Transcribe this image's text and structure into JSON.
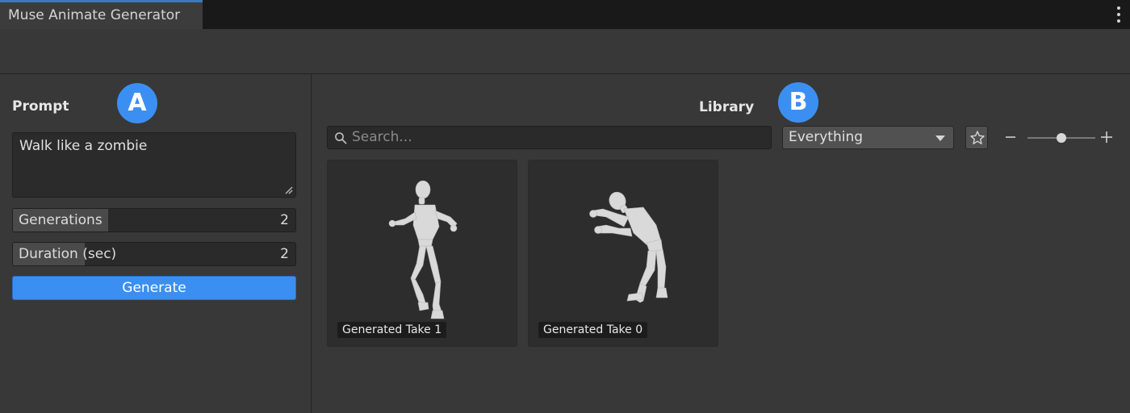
{
  "window": {
    "tab_title": "Muse Animate Generator"
  },
  "left_panel": {
    "title": "Prompt",
    "badge": "A",
    "prompt_text": "Walk like a zombie",
    "fields": [
      {
        "label": "Generations",
        "value": "2"
      },
      {
        "label": "Duration (sec)",
        "value": "2"
      }
    ],
    "generate_label": "Generate"
  },
  "library": {
    "title": "Library",
    "badge": "B",
    "search_placeholder": "Search...",
    "filter_value": "Everything",
    "zoom_level": 0.5,
    "items": [
      {
        "label": "Generated Take 1"
      },
      {
        "label": "Generated Take 0"
      }
    ]
  },
  "colors": {
    "accent": "#3b8ff2",
    "tab_highlight": "#3a79bb",
    "panel_bg": "#383838"
  },
  "icons": {
    "menu": "kebab-menu-icon",
    "resize": "resize-handle-icon",
    "search": "search-icon",
    "dropdown": "chevron-down-icon",
    "favorite": "star-icon",
    "zoom_out": "minus-icon",
    "zoom_in": "plus-icon"
  }
}
